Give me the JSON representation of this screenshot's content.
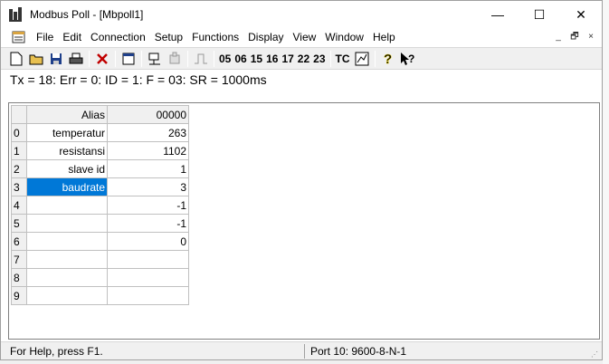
{
  "window": {
    "title": "Modbus Poll - [Mbpoll1]",
    "controls": {
      "minimize": "—",
      "maximize": "☐",
      "close": "✕"
    }
  },
  "menu": {
    "items": [
      "File",
      "Edit",
      "Connection",
      "Setup",
      "Functions",
      "Display",
      "View",
      "Window",
      "Help"
    ],
    "mdi": {
      "minimize": "_",
      "restore": "🗗",
      "close": "×"
    }
  },
  "toolbar": {
    "function_codes": [
      "05",
      "06",
      "15",
      "16",
      "17",
      "22",
      "23"
    ],
    "tc_label": "TC"
  },
  "status_line": "Tx = 18: Err = 0: ID = 1: F = 03: SR = 1000ms",
  "grid": {
    "header": {
      "alias": "Alias",
      "address": "00000"
    },
    "rows": [
      {
        "num": "0",
        "alias": "temperatur",
        "value": "263"
      },
      {
        "num": "1",
        "alias": "resistansi",
        "value": "1102"
      },
      {
        "num": "2",
        "alias": "slave id",
        "value": "1"
      },
      {
        "num": "3",
        "alias": "baudrate",
        "value": "3"
      },
      {
        "num": "4",
        "alias": "",
        "value": "-1"
      },
      {
        "num": "5",
        "alias": "",
        "value": "-1"
      },
      {
        "num": "6",
        "alias": "",
        "value": "0"
      },
      {
        "num": "7",
        "alias": "",
        "value": ""
      },
      {
        "num": "8",
        "alias": "",
        "value": ""
      },
      {
        "num": "9",
        "alias": "",
        "value": ""
      }
    ],
    "selected_row": 3
  },
  "statusbar": {
    "help": "For Help, press F1.",
    "port": "Port 10: 9600-8-N-1"
  },
  "colors": {
    "selection": "#0078d7",
    "header_bg": "#f0f0f0"
  }
}
